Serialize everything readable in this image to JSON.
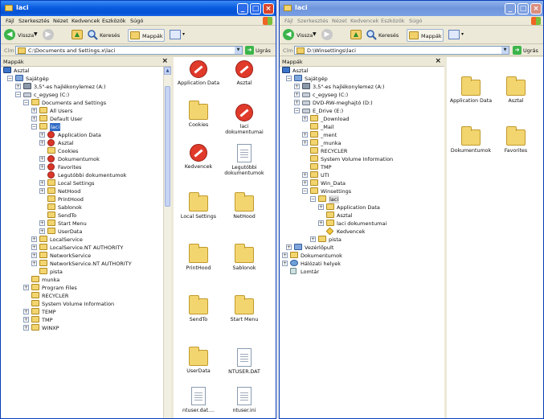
{
  "left": {
    "title": "laci",
    "menu": [
      "Fájl",
      "Szerkesztés",
      "Nézet",
      "Kedvencek",
      "Eszközök",
      "Súgó"
    ],
    "toolbar": {
      "back": "Vissza",
      "search": "Keresés",
      "folders": "Mappák"
    },
    "address": {
      "label": "Cím",
      "value": "C:\\Documents and Settings.x\\laci",
      "go": "Ugrás"
    },
    "pane_title": "Mappák",
    "tree": [
      {
        "label": "Asztal"
      },
      {
        "label": "Sajátgép"
      },
      {
        "label": "3,5\"-es hajlékonylemez (A:)"
      },
      {
        "label": "c_egyseg (C:)"
      },
      {
        "label": "Documents and Settings"
      },
      {
        "label": "All Users"
      },
      {
        "label": "Default User"
      },
      {
        "label": "laci"
      },
      {
        "label": "Application Data"
      },
      {
        "label": "Asztal"
      },
      {
        "label": "Cookies"
      },
      {
        "label": "Dokumentumok"
      },
      {
        "label": "Favorites"
      },
      {
        "label": "Legutóbbi dokumentumok"
      },
      {
        "label": "Local Settings"
      },
      {
        "label": "NetHood"
      },
      {
        "label": "PrintHood"
      },
      {
        "label": "Sablonok"
      },
      {
        "label": "SendTo"
      },
      {
        "label": "Start Menu"
      },
      {
        "label": "UserData"
      },
      {
        "label": "LocalService"
      },
      {
        "label": "LocalService.NT AUTHORITY"
      },
      {
        "label": "NetworkService"
      },
      {
        "label": "NetworkService.NT AUTHORITY"
      },
      {
        "label": "pista"
      },
      {
        "label": "munka"
      },
      {
        "label": "Program Files"
      },
      {
        "label": "RECYCLER"
      },
      {
        "label": "System Volume Information"
      },
      {
        "label": "TEMP"
      },
      {
        "label": "TMP"
      },
      {
        "label": "WINXP"
      }
    ],
    "files": [
      {
        "label": "Application Data"
      },
      {
        "label": "Asztal"
      },
      {
        "label": "Cookies"
      },
      {
        "label": "laci dokumentumai"
      },
      {
        "label": "Kedvencek"
      },
      {
        "label": "Legutóbbi dokumentumok"
      },
      {
        "label": "Local Settings"
      },
      {
        "label": "NetHood"
      },
      {
        "label": "PrintHood"
      },
      {
        "label": "Sablonok"
      },
      {
        "label": "SendTo"
      },
      {
        "label": "Start Menu"
      },
      {
        "label": "UserData"
      },
      {
        "label": "NTUSER.DAT"
      },
      {
        "label": "ntuser.dat...."
      },
      {
        "label": "ntuser.ini"
      }
    ]
  },
  "right": {
    "title": "laci",
    "menu": [
      "Fájl",
      "Szerkesztés",
      "Nézet",
      "Kedvencek",
      "Eszközök",
      "Súgó"
    ],
    "toolbar": {
      "back": "Vissza",
      "search": "Keresés",
      "folders": "Mappák"
    },
    "address": {
      "label": "Cím",
      "value": "D:\\Winsettings\\laci",
      "go": "Ugrás"
    },
    "pane_title": "Mappák",
    "tree": [
      {
        "label": "Asztal"
      },
      {
        "label": "Sajátgép"
      },
      {
        "label": "3,5\"-es hajlékonylemez (A:)"
      },
      {
        "label": "c_egyseg (C:)"
      },
      {
        "label": "DVD-RW-meghajtó (D:)"
      },
      {
        "label": "E_Drive (E:)"
      },
      {
        "label": "_Download"
      },
      {
        "label": "_Mail"
      },
      {
        "label": "_ment"
      },
      {
        "label": "_munka"
      },
      {
        "label": "RECYCLER"
      },
      {
        "label": "System Volume Information"
      },
      {
        "label": "TMP"
      },
      {
        "label": "UTI"
      },
      {
        "label": "Win_Data"
      },
      {
        "label": "Winsettings"
      },
      {
        "label": "laci"
      },
      {
        "label": "Application Data"
      },
      {
        "label": "Asztal"
      },
      {
        "label": "laci dokumentumai"
      },
      {
        "label": "Kedvencek"
      },
      {
        "label": "pista"
      },
      {
        "label": "Vezérlőpult"
      },
      {
        "label": "Dokumentumok"
      },
      {
        "label": "Hálózati helyek"
      },
      {
        "label": "Lomtár"
      }
    ],
    "files": [
      {
        "label": "Application Data"
      },
      {
        "label": "Asztal"
      },
      {
        "label": "Dokumentumok"
      },
      {
        "label": "Favorites"
      }
    ]
  }
}
